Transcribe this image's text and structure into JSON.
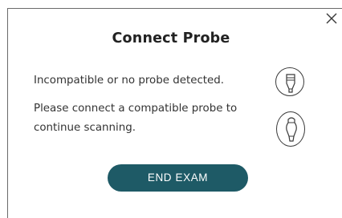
{
  "dialog": {
    "title": "Connect Probe",
    "message_primary": "Incompatible or no probe detected.",
    "message_secondary": "Please connect a compatible probe to continue scanning.",
    "end_button_label": "END EXAM",
    "close_icon": "close-icon",
    "probe_icons": [
      "linear-probe-icon",
      "convex-probe-icon"
    ]
  },
  "colors": {
    "accent": "#1e5a66",
    "border": "#6a6a6a",
    "text": "#333333"
  }
}
